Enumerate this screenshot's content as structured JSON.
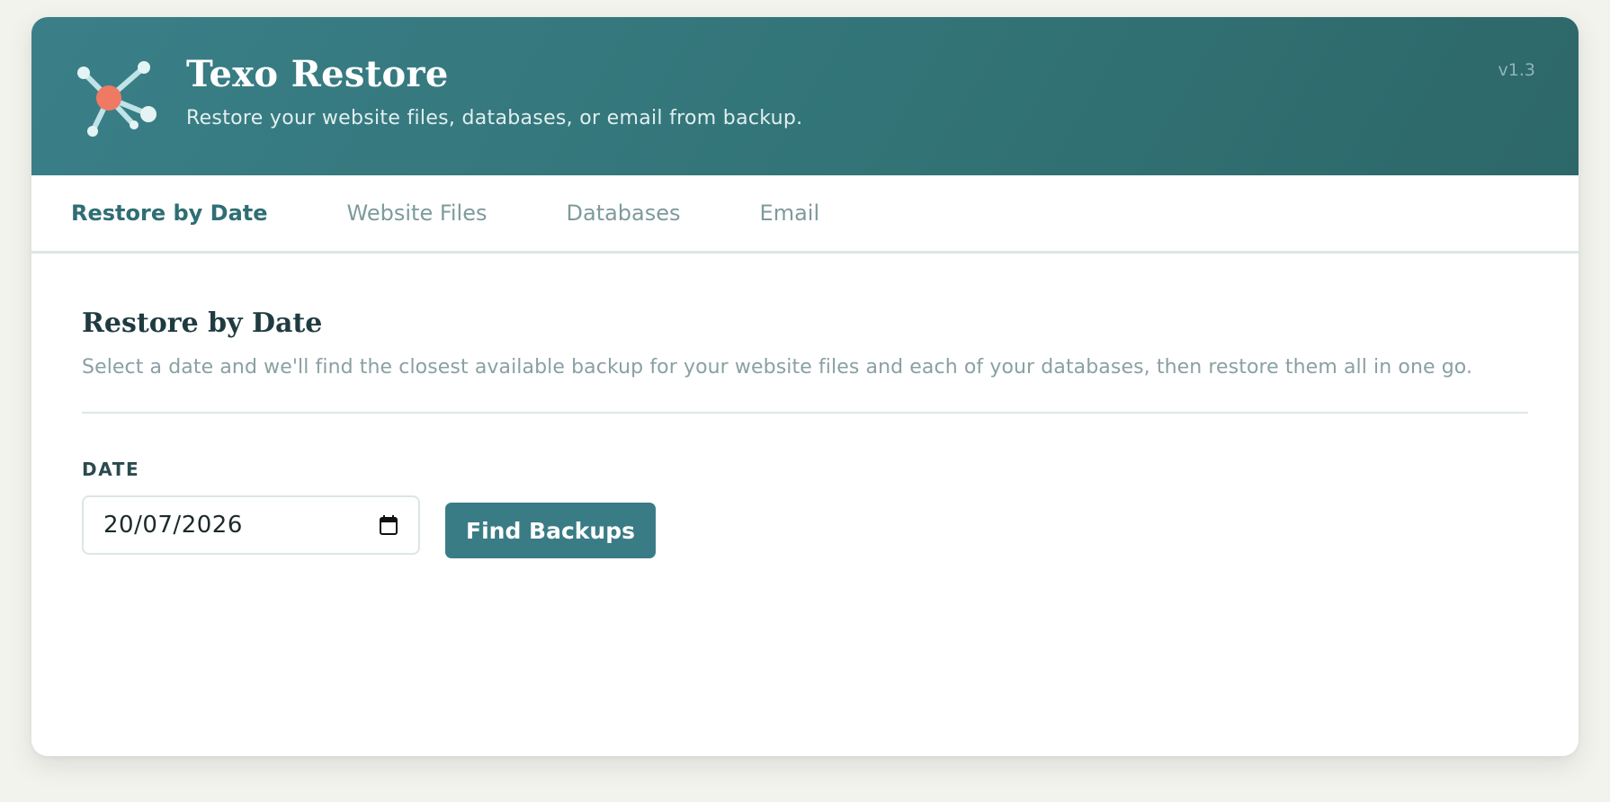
{
  "app": {
    "title": "Texo Restore",
    "subtitle": "Restore your website files, databases, or email from backup.",
    "version": "v1.3",
    "logo_icon": "network-hub-icon"
  },
  "tabs": [
    {
      "label": "Restore by Date",
      "active": true
    },
    {
      "label": "Website Files",
      "active": false
    },
    {
      "label": "Databases",
      "active": false
    },
    {
      "label": "Email",
      "active": false
    }
  ],
  "main": {
    "title": "Restore by Date",
    "description": "Select a date and we'll find the closest available backup for your website files and each of your databases, then restore them all in one go.",
    "date_field": {
      "label": "DATE",
      "value": "20/07/2026",
      "icon": "calendar-icon"
    },
    "find_button_label": "Find Backups"
  },
  "colors": {
    "header": "#337779",
    "accent": "#3a7c85",
    "logo_node": "#ef7a63",
    "logo_lines": "#bfe3e7"
  }
}
